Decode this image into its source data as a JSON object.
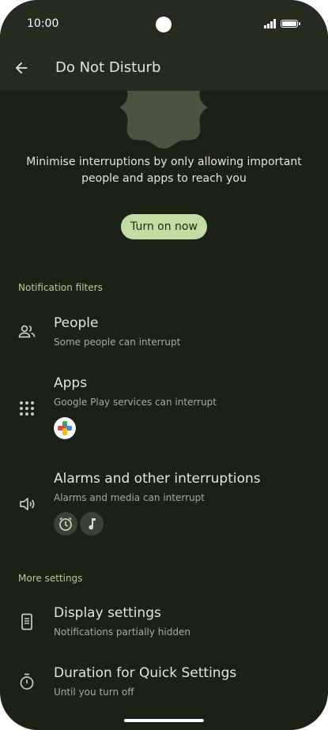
{
  "status_bar": {
    "time": "10:00"
  },
  "app_bar": {
    "title": "Do Not Disturb"
  },
  "intro": {
    "description": "Minimise interruptions by only allowing important people and apps to reach you",
    "turn_on_label": "Turn on now"
  },
  "notification_filters": {
    "header": "Notification filters",
    "items": [
      {
        "title": "People",
        "subtitle": "Some people can interrupt",
        "icon": "people-icon"
      },
      {
        "title": "Apps",
        "subtitle": "Google Play services can interrupt",
        "icon": "apps-grid-icon"
      },
      {
        "title": "Alarms and other interruptions",
        "subtitle": "Alarms and media can interrupt",
        "icon": "volume-icon"
      }
    ]
  },
  "more_settings": {
    "header": "More settings",
    "items": [
      {
        "title": "Display settings",
        "subtitle": "Notifications partially hidden",
        "icon": "phone-display-icon"
      },
      {
        "title": "Duration for Quick Settings",
        "subtitle": "Until you turn off",
        "icon": "timer-icon"
      }
    ]
  },
  "colors": {
    "background": "#1c2118",
    "app_bar": "#252b20",
    "accent_button": "#c4dca4",
    "section_header": "#b8cc99"
  }
}
